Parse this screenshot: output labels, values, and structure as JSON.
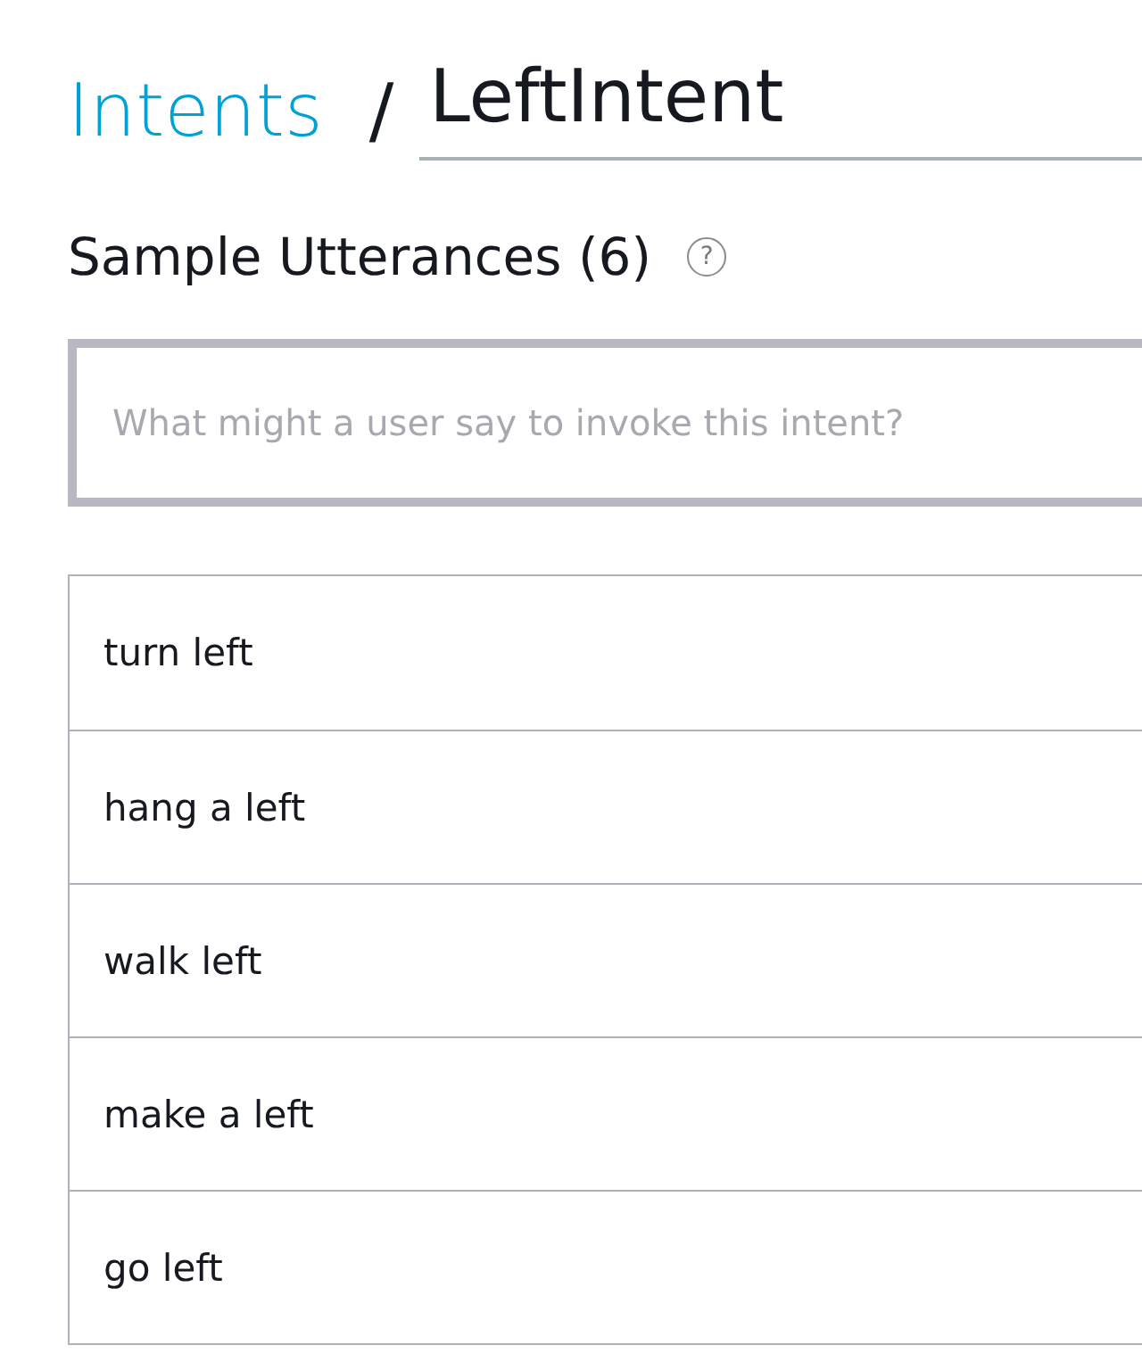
{
  "breadcrumb": {
    "parent": "Intents",
    "separator": "/",
    "intent_name": "LeftIntent"
  },
  "section": {
    "title": "Sample Utterances (6)",
    "help": "?"
  },
  "utterance_input": {
    "placeholder": "What might a user say to invoke this intent?"
  },
  "utterances": [
    "turn left",
    "hang a left",
    "walk left",
    "make a left",
    "go left"
  ]
}
